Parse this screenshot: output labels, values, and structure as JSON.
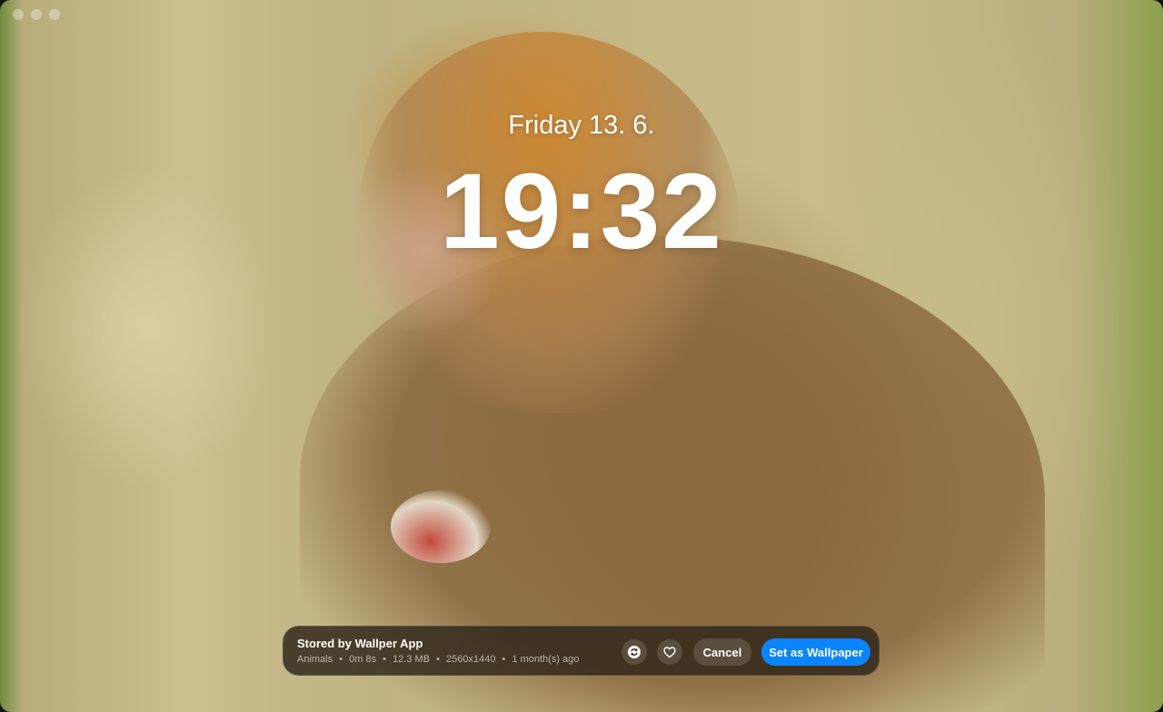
{
  "lock_screen": {
    "date": "Friday 13. 6.",
    "time": "19:32"
  },
  "info_bar": {
    "title": "Stored by Wallper App",
    "meta": {
      "category": "Animals",
      "duration": "0m 8s",
      "size": "12.3 MB",
      "resolution": "2560x1440",
      "age": "1 month(s) ago",
      "separator": "•"
    },
    "icons": {
      "refresh": "refresh-icon",
      "favorite": "heart-icon"
    },
    "cancel_label": "Cancel",
    "primary_label": "Set as Wallpaper"
  },
  "colors": {
    "primary_button": "#0a84ff",
    "bar_background": "#2e2418"
  }
}
